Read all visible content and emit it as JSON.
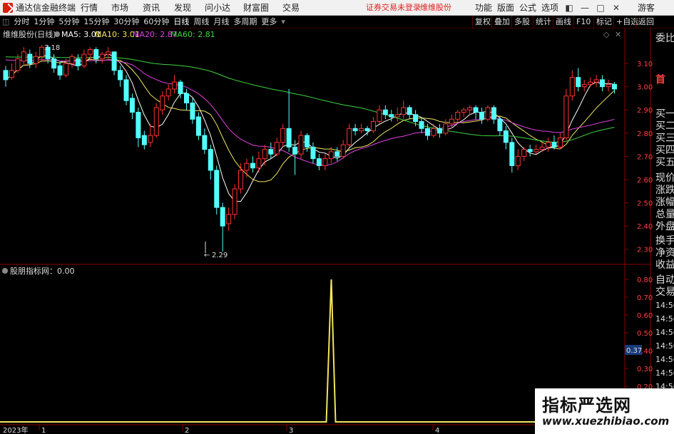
{
  "titlebar": {
    "app_name": "通达信金融终端",
    "menus": [
      "行情",
      "市场",
      "资讯",
      "发现",
      "问小达",
      "财富圈",
      "交易"
    ],
    "status_text": "证券交易未登录",
    "stock_link": "维维股份",
    "right_menus": [
      "功能",
      "版面",
      "公式",
      "选项"
    ],
    "guest_label": "游客"
  },
  "period_bar": {
    "items": [
      "分时",
      "1分钟",
      "5分钟",
      "15分钟",
      "30分钟",
      "60分钟",
      "日线",
      "周线",
      "月线",
      "多周期",
      "更多"
    ],
    "active": "日线",
    "right_buttons": [
      "复权",
      "叠加",
      "多股",
      "统计",
      "画线",
      "F10",
      "标记",
      "+自选",
      "返回"
    ]
  },
  "main_chart": {
    "stock_title": "维维股份(日线)",
    "indicators": [
      {
        "label": "MA5: 3.01",
        "color": "#ffffff"
      },
      {
        "label": "MA10: 3.01",
        "color": "#f2e65a"
      },
      {
        "label": "MA20: 2.87",
        "color": "#e040e0"
      },
      {
        "label": "MA60: 2.81",
        "color": "#3fd33f"
      }
    ],
    "high_marker": "3.18",
    "low_marker": "2.29",
    "price_ticks": [
      "3.10",
      "3.00",
      "2.90",
      "2.80",
      "2.70",
      "2.60",
      "2.50",
      "2.40",
      "2.30"
    ]
  },
  "sub_chart": {
    "indicator_label": "股朋指标网：0.00",
    "value_ticks": [
      "0.80",
      "0.70",
      "0.60",
      "0.50",
      "0.40",
      "0.30",
      "0.20",
      "0.10"
    ],
    "current_value": "0.37",
    "x_labels": [
      "2023年",
      "1",
      "2",
      "3",
      "4"
    ]
  },
  "side_panel": {
    "top_label": "委比",
    "head_label": "首",
    "rows": [
      "买一",
      "买二",
      "买三",
      "买四",
      "买五",
      "现价",
      "涨跌",
      "涨幅",
      "总量",
      "外盘",
      "换手",
      "净资",
      "收益"
    ],
    "mid_rows": [
      "自动",
      "交易"
    ],
    "times": [
      "14:56",
      "14:56",
      "14:56",
      "14:56",
      "14:56",
      "14:56",
      "14:56"
    ]
  },
  "watermark": {
    "title": "指标严选网",
    "url": "www.xuezhibiao.com"
  },
  "chart_data": {
    "type": "candlestick",
    "title": "维维股份(日线)",
    "ylim": [
      2.25,
      3.2
    ],
    "candles": [
      [
        3.07,
        3.03,
        3.09,
        3.0
      ],
      [
        3.04,
        3.07,
        3.1,
        3.03
      ],
      [
        3.07,
        3.12,
        3.14,
        3.06
      ],
      [
        3.11,
        3.15,
        3.17,
        3.09
      ],
      [
        3.14,
        3.1,
        3.16,
        3.08
      ],
      [
        3.1,
        3.13,
        3.15,
        3.08
      ],
      [
        3.13,
        3.17,
        3.18,
        3.11
      ],
      [
        3.17,
        3.12,
        3.18,
        3.1
      ],
      [
        3.12,
        3.08,
        3.14,
        3.06
      ],
      [
        3.09,
        3.05,
        3.11,
        3.03
      ],
      [
        3.05,
        3.1,
        3.12,
        3.04
      ],
      [
        3.1,
        3.13,
        3.14,
        3.08
      ],
      [
        3.12,
        3.09,
        3.14,
        3.07
      ],
      [
        3.09,
        3.14,
        3.16,
        3.08
      ],
      [
        3.14,
        3.16,
        3.17,
        3.12
      ],
      [
        3.16,
        3.12,
        3.17,
        3.1
      ],
      [
        3.12,
        3.14,
        3.15,
        3.1
      ],
      [
        3.14,
        3.15,
        3.17,
        3.12
      ],
      [
        3.15,
        3.07,
        3.15,
        3.05
      ],
      [
        3.07,
        3.03,
        3.09,
        3.0
      ],
      [
        3.03,
        2.94,
        3.05,
        2.92
      ],
      [
        2.95,
        2.89,
        2.97,
        2.86
      ],
      [
        2.89,
        2.78,
        2.91,
        2.74
      ],
      [
        2.79,
        2.75,
        2.81,
        2.73
      ],
      [
        2.76,
        2.79,
        2.84,
        2.74
      ],
      [
        2.79,
        2.91,
        2.93,
        2.78
      ],
      [
        2.9,
        2.96,
        2.98,
        2.88
      ],
      [
        2.96,
        2.99,
        3.01,
        2.94
      ],
      [
        2.99,
        3.02,
        3.05,
        2.97
      ],
      [
        3.02,
        2.97,
        3.03,
        2.95
      ],
      [
        2.97,
        2.93,
        2.99,
        2.9
      ],
      [
        2.93,
        2.86,
        2.95,
        2.84
      ],
      [
        2.87,
        2.79,
        2.89,
        2.77
      ],
      [
        2.79,
        2.73,
        2.82,
        2.71
      ],
      [
        2.73,
        2.64,
        2.75,
        2.6
      ],
      [
        2.64,
        2.48,
        2.66,
        2.45
      ],
      [
        2.48,
        2.4,
        2.5,
        2.29
      ],
      [
        2.41,
        2.45,
        2.48,
        2.38
      ],
      [
        2.45,
        2.56,
        2.58,
        2.43
      ],
      [
        2.56,
        2.64,
        2.67,
        2.54
      ],
      [
        2.64,
        2.67,
        2.69,
        2.61
      ],
      [
        2.67,
        2.65,
        2.7,
        2.63
      ],
      [
        2.65,
        2.69,
        2.72,
        2.63
      ],
      [
        2.69,
        2.73,
        2.75,
        2.66
      ],
      [
        2.73,
        2.71,
        2.76,
        2.69
      ],
      [
        2.71,
        2.76,
        2.78,
        2.7
      ],
      [
        2.76,
        2.82,
        2.84,
        2.74
      ],
      [
        2.82,
        2.74,
        2.99,
        2.72
      ],
      [
        2.74,
        2.71,
        2.77,
        2.62
      ],
      [
        2.71,
        2.79,
        2.81,
        2.69
      ],
      [
        2.79,
        2.74,
        2.8,
        2.72
      ],
      [
        2.74,
        2.69,
        2.76,
        2.67
      ],
      [
        2.69,
        2.66,
        2.71,
        2.64
      ],
      [
        2.66,
        2.69,
        2.71,
        2.64
      ],
      [
        2.69,
        2.72,
        2.74,
        2.67
      ],
      [
        2.72,
        2.7,
        2.74,
        2.68
      ],
      [
        2.7,
        2.75,
        2.77,
        2.69
      ],
      [
        2.75,
        2.82,
        2.84,
        2.74
      ],
      [
        2.82,
        2.81,
        2.84,
        2.79
      ],
      [
        2.81,
        2.82,
        2.84,
        2.8
      ],
      [
        2.82,
        2.81,
        2.83,
        2.79
      ],
      [
        2.81,
        2.85,
        2.87,
        2.8
      ],
      [
        2.85,
        2.9,
        2.92,
        2.84
      ],
      [
        2.9,
        2.88,
        2.92,
        2.86
      ],
      [
        2.88,
        2.87,
        2.9,
        2.85
      ],
      [
        2.87,
        2.88,
        2.91,
        2.85
      ],
      [
        2.88,
        2.91,
        2.94,
        2.86
      ],
      [
        2.91,
        2.88,
        2.92,
        2.86
      ],
      [
        2.88,
        2.85,
        2.9,
        2.83
      ],
      [
        2.85,
        2.82,
        2.87,
        2.8
      ],
      [
        2.82,
        2.79,
        2.84,
        2.77
      ],
      [
        2.79,
        2.82,
        2.84,
        2.78
      ],
      [
        2.82,
        2.8,
        2.84,
        2.78
      ],
      [
        2.8,
        2.84,
        2.86,
        2.79
      ],
      [
        2.84,
        2.86,
        2.88,
        2.82
      ],
      [
        2.86,
        2.89,
        2.9,
        2.85
      ],
      [
        2.89,
        2.9,
        2.91,
        2.87
      ],
      [
        2.9,
        2.91,
        2.92,
        2.88
      ],
      [
        2.91,
        2.89,
        2.92,
        2.86
      ],
      [
        2.89,
        2.86,
        2.91,
        2.84
      ],
      [
        2.86,
        2.91,
        2.92,
        2.85
      ],
      [
        2.91,
        2.86,
        2.92,
        2.84
      ],
      [
        2.86,
        2.81,
        2.87,
        2.79
      ],
      [
        2.81,
        2.76,
        2.83,
        2.73
      ],
      [
        2.76,
        2.66,
        2.78,
        2.63
      ],
      [
        2.66,
        2.7,
        2.73,
        2.64
      ],
      [
        2.7,
        2.73,
        2.74,
        2.68
      ],
      [
        2.73,
        2.72,
        2.75,
        2.7
      ],
      [
        2.72,
        2.73,
        2.75,
        2.71
      ],
      [
        2.73,
        2.74,
        2.76,
        2.72
      ],
      [
        2.74,
        2.76,
        2.78,
        2.72
      ],
      [
        2.76,
        2.74,
        2.79,
        2.73
      ],
      [
        2.74,
        2.78,
        2.8,
        2.73
      ],
      [
        2.78,
        2.96,
        2.99,
        2.77
      ],
      [
        2.96,
        3.04,
        3.07,
        2.94
      ],
      [
        3.04,
        3.0,
        3.08,
        2.98
      ],
      [
        3.0,
        3.01,
        3.03,
        2.98
      ],
      [
        3.01,
        3.02,
        3.04,
        3.0
      ],
      [
        3.02,
        3.03,
        3.05,
        3.0
      ],
      [
        3.03,
        3.0,
        3.05,
        2.98
      ],
      [
        3.0,
        3.01,
        3.03,
        2.98
      ],
      [
        3.01,
        2.99,
        3.02,
        2.97
      ]
    ],
    "sub_series": {
      "name": "股朋指标网",
      "spike_index": 50,
      "spike_value": 0.8,
      "baseline": 0.0
    },
    "ma_colors": {
      "MA5": "#ffffff",
      "MA10": "#f2e65a",
      "MA20": "#e040e0",
      "MA60": "#3fd33f"
    },
    "up_color": "#ff3333",
    "down_color": "#54ffff"
  }
}
